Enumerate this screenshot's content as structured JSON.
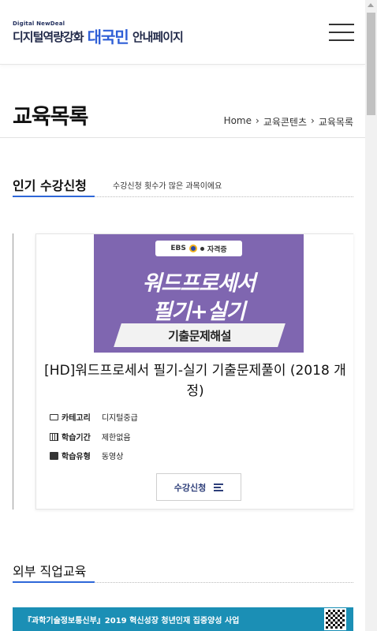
{
  "header": {
    "logo_small": "Digital NewDeal",
    "logo_part1": "디지털역량강화",
    "logo_part2": "대국민",
    "logo_part3": "안내페이지",
    "menu_icon": "hamburger-menu-icon"
  },
  "page": {
    "title": "교육목록",
    "breadcrumb": [
      "Home",
      "교육콘텐츠",
      "교육목록"
    ],
    "breadcrumb_separator": "›"
  },
  "popular": {
    "heading": "인기 수강신청",
    "description": "수강신청 횟수가 많은 과목이에요"
  },
  "course": {
    "thumb_badge_ebs": "EBS",
    "thumb_badge_cert": "자격증",
    "thumb_line1": "워드프로세서",
    "thumb_line2": "필기+실기",
    "thumb_banner": "기출문제해설",
    "title": "[HD]워드프로세서 필기-실기 기출문제풀이 (2018 개정)",
    "meta": [
      {
        "icon": "monitor-icon",
        "label": "카테고리",
        "value": "디지털중급"
      },
      {
        "icon": "calendar-icon",
        "label": "학습기간",
        "value": "제한없음"
      },
      {
        "icon": "box-icon",
        "label": "학습유형",
        "value": "동영상"
      }
    ],
    "apply_label": "수강신청"
  },
  "external": {
    "heading": "외부 직업교육",
    "banner_text": "『과학기술정보통신부』2019 혁신성장 청년인재 집중양성 사업"
  },
  "colors": {
    "accent": "#2e67d8",
    "thumb_bg": "#7f66b0",
    "banner_bg": "#1b8fb5",
    "logo_blue": "#2f5fd6"
  }
}
